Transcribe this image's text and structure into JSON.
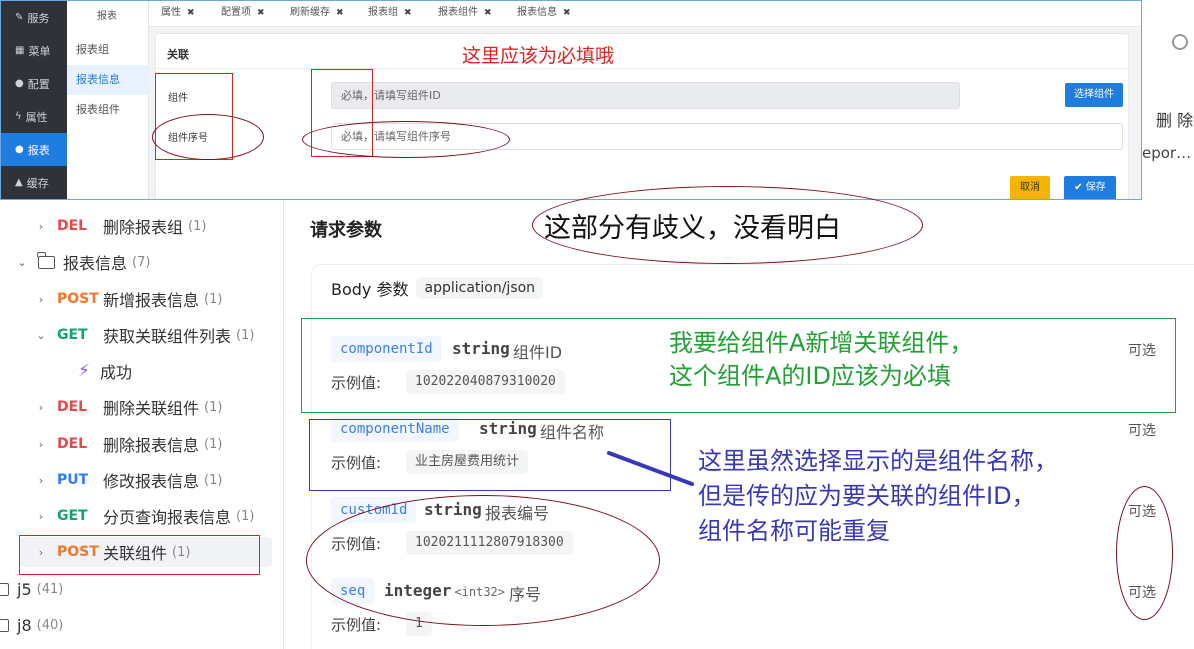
{
  "tree": {
    "rows": [
      {
        "type": "endpoint",
        "chevron": "›",
        "method": "DEL",
        "method_class": "m-del",
        "label": "删除报表组",
        "count": "(1)"
      },
      {
        "type": "folder",
        "chevron": "⌄",
        "label": "报表信息",
        "count": "(7)"
      },
      {
        "type": "endpoint",
        "chevron": "›",
        "method": "POST",
        "method_class": "m-post",
        "label": "新增报表信息",
        "count": "(1)"
      },
      {
        "type": "endpoint",
        "chevron": "⌄",
        "method": "GET",
        "method_class": "m-get",
        "label": "获取关联组件列表",
        "count": "(1)"
      },
      {
        "type": "response",
        "label": "成功"
      },
      {
        "type": "endpoint",
        "chevron": "›",
        "method": "DEL",
        "method_class": "m-del",
        "label": "删除关联组件",
        "count": "(1)"
      },
      {
        "type": "endpoint",
        "chevron": "›",
        "method": "DEL",
        "method_class": "m-del",
        "label": "删除报表信息",
        "count": "(1)"
      },
      {
        "type": "endpoint",
        "chevron": "›",
        "method": "PUT",
        "method_class": "m-put",
        "label": "修改报表信息",
        "count": "(1)"
      },
      {
        "type": "endpoint",
        "chevron": "›",
        "method": "GET",
        "method_class": "m-get",
        "label": "分页查询报表信息",
        "count": "(1)"
      },
      {
        "type": "endpoint",
        "chevron": "›",
        "method": "POST",
        "method_class": "m-post",
        "label": "关联组件",
        "count": "(1)",
        "selected": true
      },
      {
        "type": "root-folder",
        "label": "j5",
        "count": "(41)"
      },
      {
        "type": "root-folder",
        "label": "j8",
        "count": "(40)"
      }
    ]
  },
  "right_strip": {
    "delete_label": "删 除",
    "report_fragment": "epor…"
  },
  "request": {
    "section_title": "请求参数",
    "body_label": "Body 参数",
    "content_type": "application/json",
    "params": [
      {
        "name": "componentId",
        "type": "string",
        "format": "",
        "desc": "组件ID",
        "example_label": "示例值:",
        "example": "102022040879310020",
        "required": "可选"
      },
      {
        "name": "componentName",
        "type": "string",
        "format": "",
        "desc": "组件名称",
        "example_label": "示例值:",
        "example": "业主房屋费用统计",
        "required": "可选"
      },
      {
        "name": "customId",
        "type": "string",
        "format": "",
        "desc": "报表编号",
        "example_label": "示例值:",
        "example": "1020211112807918300",
        "required": "可选"
      },
      {
        "name": "seq",
        "type": "integer",
        "format": "<int32>",
        "desc": "序号",
        "example_label": "示例值:",
        "example": "1",
        "required": "可选"
      }
    ]
  },
  "admin": {
    "nav": [
      {
        "icon": "✎",
        "icon_name": "edit-icon",
        "label": "服务"
      },
      {
        "icon": "▦",
        "icon_name": "grid-icon",
        "label": "菜单"
      },
      {
        "icon": "●",
        "icon_name": "globe-icon",
        "label": "配置"
      },
      {
        "icon": "ϟ",
        "icon_name": "bolt-icon",
        "label": "属性"
      },
      {
        "icon": "●",
        "icon_name": "globe-icon",
        "label": "报表",
        "active": true
      },
      {
        "icon": "▲",
        "icon_name": "cache-icon",
        "label": "缓存"
      }
    ],
    "sub_header": "报表",
    "sub_items": [
      {
        "label": "报表组"
      },
      {
        "label": "报表信息",
        "active": true
      },
      {
        "label": "报表组件"
      }
    ],
    "tabs": [
      {
        "label": "属性"
      },
      {
        "label": "配置项"
      },
      {
        "label": "刷新缓存"
      },
      {
        "label": "报表组"
      },
      {
        "label": "报表组件"
      },
      {
        "label": "报表信息"
      }
    ],
    "tab_close": "✖",
    "dialog": {
      "title": "关联",
      "component_label": "组件",
      "component_placeholder": "必填，请填写组件ID",
      "seq_label": "组件序号",
      "seq_placeholder": "必填，请填写组件序号",
      "select_button": "选择组件",
      "cancel_button": "取消",
      "save_button": "✔ 保存"
    }
  },
  "annotations": {
    "required_note": "这里应该为必填哦",
    "ambiguous_note": "这部分有歧义，没看明白",
    "component_a_note": [
      "我要给组件A新增关联组件，",
      "这个组件A的ID应该为必填"
    ],
    "component_name_note": [
      "这里虽然选择显示的是组件名称，",
      "但是传的应为要关联的组件ID，",
      "组件名称可能重复"
    ],
    "colors": {
      "red": "#e22020",
      "dark_red": "#7a0f1a",
      "green": "#22a235",
      "blue": "#3939b8"
    }
  }
}
